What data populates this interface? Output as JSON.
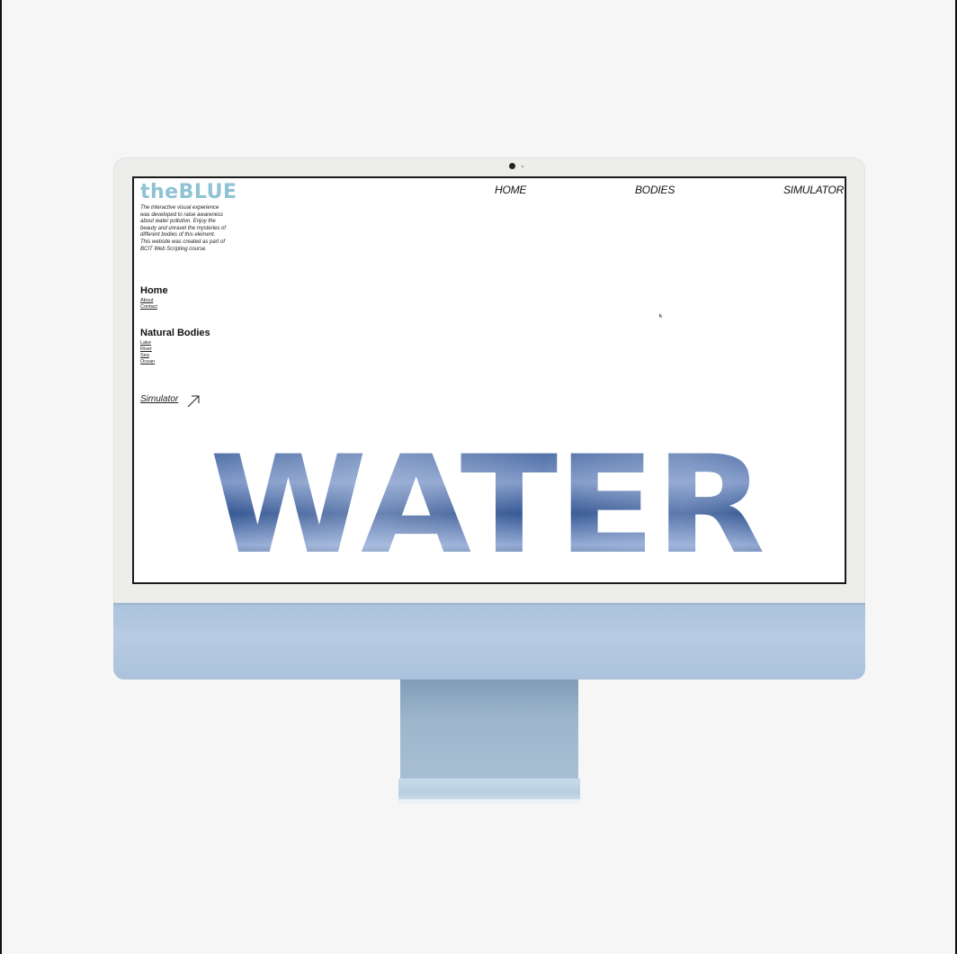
{
  "site": {
    "brand": "theBLUE",
    "intro": "The interactive visual experience was developed to raise awareness about water pollution. Enjoy the beauty and unravel the mysteries of different bodies of this element. This website was created as part of BCIT Web Scripting course."
  },
  "nav": {
    "home": "HOME",
    "bodies": "BODIES",
    "simulator": "SIMULATOR"
  },
  "sidebar": {
    "home_title": "Home",
    "home_links": [
      "About",
      "Contact"
    ],
    "bodies_title": "Natural Bodies",
    "bodies_links": [
      "Lake",
      "River",
      "Sea",
      "Ocean"
    ],
    "simulator_link": "Simulator"
  },
  "hero": {
    "word": "WATER"
  },
  "colors": {
    "brand": "#8fc2d4",
    "water_dark": "#12305e",
    "water_light": "#a9bde0",
    "chin": "#b7cbe2"
  },
  "icons": {
    "simulator_arrow": "arrow-up-right-icon",
    "camera": "camera-icon"
  }
}
